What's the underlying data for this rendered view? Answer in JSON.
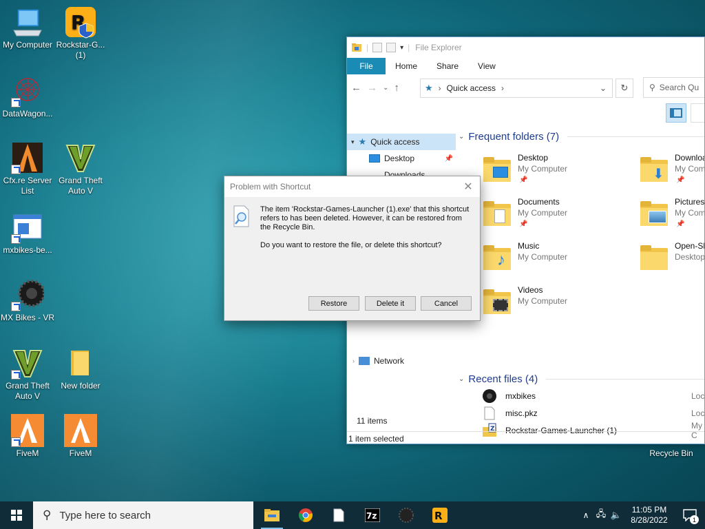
{
  "desktop": {
    "icons": [
      {
        "id": "my-computer",
        "label": "My Computer"
      },
      {
        "id": "rockstar",
        "label": "Rockstar-G... (1)"
      },
      {
        "id": "datawagon",
        "label": "DataWagon..."
      },
      {
        "id": "cfx",
        "label": "Cfx.re Server List"
      },
      {
        "id": "gta-top",
        "label": "Grand Theft Auto V"
      },
      {
        "id": "mxbikes-be",
        "label": "mxbikes-be..."
      },
      {
        "id": "mxbikes-vr",
        "label": "MX Bikes - VR"
      },
      {
        "id": "gta-bottom",
        "label": "Grand Theft Auto V"
      },
      {
        "id": "new-folder",
        "label": "New folder"
      },
      {
        "id": "fivem-1",
        "label": "FiveM"
      },
      {
        "id": "fivem-2",
        "label": "FiveM"
      },
      {
        "id": "recycle",
        "label": "Recycle Bin"
      }
    ]
  },
  "explorer": {
    "title": "File Explorer",
    "tabs": {
      "file": "File",
      "home": "Home",
      "share": "Share",
      "view": "View"
    },
    "address": "Quick access",
    "search_placeholder": "Search Qu",
    "nav": {
      "quick_access": "Quick access",
      "desktop": "Desktop",
      "downloads": "Downloads",
      "network": "Network"
    },
    "frequent_title": "Frequent folders (7)",
    "folders": [
      {
        "name": "Desktop",
        "loc": "My Computer"
      },
      {
        "name": "Downloa",
        "loc": "My Com"
      },
      {
        "name": "Documents",
        "loc": "My Computer"
      },
      {
        "name": "Pictures",
        "loc": "My Com"
      },
      {
        "name": "Music",
        "loc": "My Computer"
      },
      {
        "name": "Open-Sh",
        "loc": "Desktop"
      },
      {
        "name": "Videos",
        "loc": "My Computer"
      }
    ],
    "recent_title": "Recent files (4)",
    "recent": [
      {
        "name": "mxbikes",
        "loc": "Loca"
      },
      {
        "name": "misc.pkz",
        "loc": "Loca"
      },
      {
        "name": "Rockstar-Games-Launcher (1)",
        "loc": "My C"
      }
    ],
    "status_items": "11 items",
    "status_selected": "1 item selected"
  },
  "dialog": {
    "title": "Problem with Shortcut",
    "message": "The item 'Rockstar-Games-Launcher (1).exe' that this shortcut refers to has been deleted. However, it can be restored from the Recycle Bin.",
    "question": "Do you want to restore the file, or delete this shortcut?",
    "buttons": {
      "restore": "Restore",
      "delete": "Delete it",
      "cancel": "Cancel"
    }
  },
  "taskbar": {
    "search_placeholder": "Type here to search",
    "time": "11:05 PM",
    "date": "8/28/2022",
    "notification_count": "1"
  },
  "colors": {
    "accent": "#1a8bb5",
    "taskbar": "#0f2c38",
    "folder": "#f0c54a"
  }
}
